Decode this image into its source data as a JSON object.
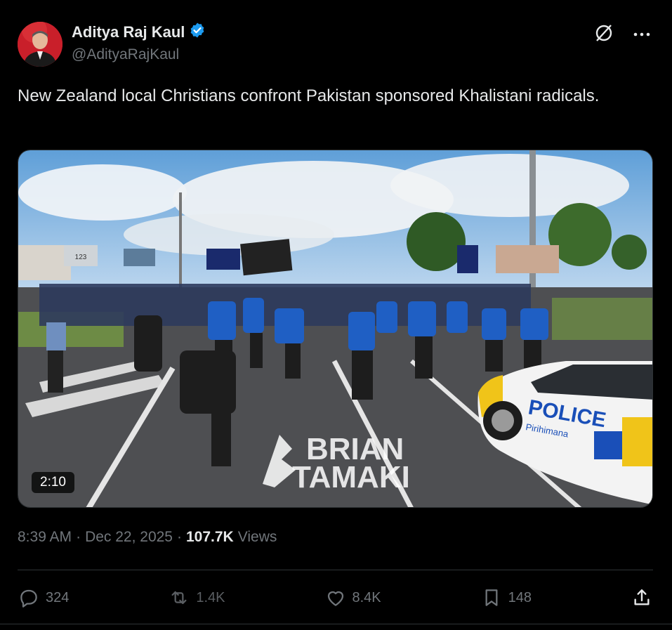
{
  "author": {
    "name": "Aditya Raj Kaul",
    "handle": "@AdityaRajKaul",
    "verified": true
  },
  "tweet": {
    "text": "New Zealand local Christians confront Pakistan sponsored Khalistani radicals."
  },
  "media": {
    "duration": "2:10",
    "watermark_line1": "BRIAN",
    "watermark_line2": "TAMAKI",
    "police_text": "POLICE",
    "police_subtext": "Pirihimana",
    "sign_text": "123"
  },
  "meta": {
    "time": "8:39 AM",
    "separator": "·",
    "date": "Dec 22, 2025",
    "views_count": "107.7K",
    "views_label": "Views"
  },
  "actions": {
    "replies": "324",
    "reposts": "1.4K",
    "likes": "8.4K",
    "bookmarks": "148"
  },
  "colors": {
    "background": "#000000",
    "text": "#e7e9ea",
    "secondary": "#71767b",
    "verified": "#1d9bf0",
    "divider": "#2f3336"
  }
}
